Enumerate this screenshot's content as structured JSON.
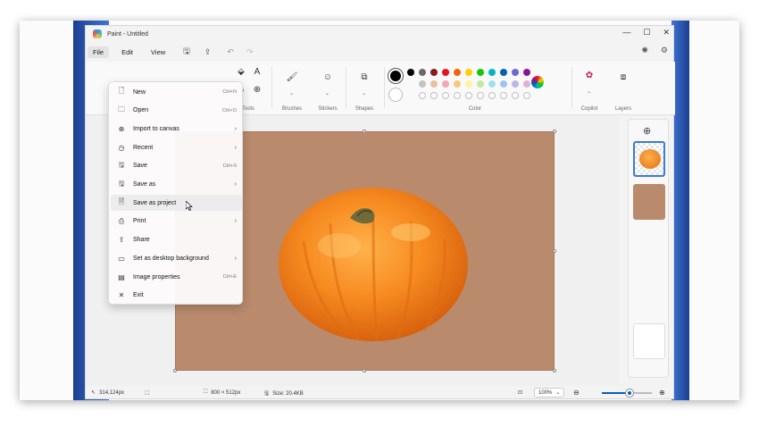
{
  "window": {
    "title": "Paint - Untitled",
    "minimize": "—",
    "maximize": "☐",
    "close": "✕"
  },
  "menubar": {
    "file": "File",
    "edit": "Edit",
    "view": "View"
  },
  "ribbon": {
    "groups": [
      {
        "label": "Tools"
      },
      {
        "label": "Brushes"
      },
      {
        "label": "Stickers"
      },
      {
        "label": "Shapes"
      },
      {
        "label": "Color"
      },
      {
        "label": "Copilot"
      },
      {
        "label": "Layers"
      }
    ],
    "palette_row1": [
      "#000000",
      "#6b6b6b",
      "#8b1a1a",
      "#e81123",
      "#f7630c",
      "#ffd100",
      "#16c60c",
      "#00b7c3",
      "#0063b1",
      "#6b69d6",
      "#881798"
    ],
    "palette_row2": [
      "#c3c3c3",
      "#e8c0a0",
      "#f4a6b2",
      "#f9c680",
      "#fff4a0",
      "#c5e8a0",
      "#a0e0ea",
      "#a0c4f0",
      "#c0b4e8",
      "#e0b0d8"
    ],
    "primary_color": "#000000",
    "secondary_color": "#ffffff"
  },
  "file_menu": {
    "items": [
      {
        "label": "New",
        "shortcut": "Ctrl+N",
        "icon": "new-file-icon",
        "glyph": "🗋"
      },
      {
        "label": "Open",
        "shortcut": "Ctrl+O",
        "icon": "folder-icon",
        "glyph": "🗀"
      },
      {
        "label": "Import to canvas",
        "arrow": "›",
        "icon": "import-icon",
        "glyph": "⊕"
      },
      {
        "label": "Recent",
        "arrow": "›",
        "icon": "clock-icon",
        "glyph": "◷"
      },
      {
        "label": "Save",
        "shortcut": "Ctrl+S",
        "icon": "save-icon",
        "glyph": "🖫"
      },
      {
        "label": "Save as",
        "arrow": "›",
        "icon": "save-as-icon",
        "glyph": "🖫"
      },
      {
        "label": "Save as project",
        "icon": "save-project-icon",
        "glyph": "🗎"
      },
      {
        "label": "Print",
        "arrow": "›",
        "icon": "print-icon",
        "glyph": "⎙"
      },
      {
        "label": "Share",
        "icon": "share-icon",
        "glyph": "⇪"
      },
      {
        "label": "Set as desktop background",
        "arrow": "›",
        "icon": "desktop-icon",
        "glyph": "▭"
      },
      {
        "label": "Image properties",
        "shortcut": "Ctrl+E",
        "icon": "properties-icon",
        "glyph": "▤"
      },
      {
        "label": "Exit",
        "icon": "exit-icon",
        "glyph": "✕"
      }
    ]
  },
  "canvas": {
    "background": "#b98a6c"
  },
  "statusbar": {
    "cursor_pos": "314,124px",
    "canvas_size": "800 × 512px",
    "file_size": "Size: 20.4KB",
    "zoom": "100%",
    "zoom_level": 0.55
  }
}
